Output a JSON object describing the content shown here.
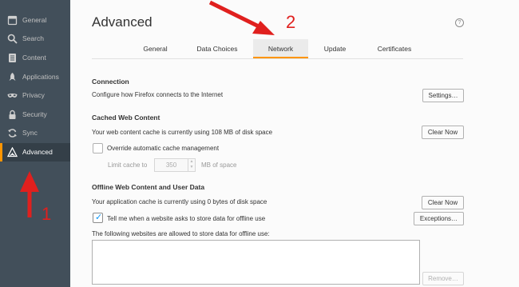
{
  "sidebar": {
    "items": [
      {
        "label": "General",
        "icon": "general-icon"
      },
      {
        "label": "Search",
        "icon": "search-icon"
      },
      {
        "label": "Content",
        "icon": "content-icon"
      },
      {
        "label": "Applications",
        "icon": "applications-icon"
      },
      {
        "label": "Privacy",
        "icon": "privacy-mask-icon"
      },
      {
        "label": "Security",
        "icon": "security-lock-icon"
      },
      {
        "label": "Sync",
        "icon": "sync-icon"
      },
      {
        "label": "Advanced",
        "icon": "advanced-icon",
        "active": true
      }
    ]
  },
  "header": {
    "title": "Advanced",
    "help_symbol": "?"
  },
  "tabs": [
    {
      "label": "General"
    },
    {
      "label": "Data Choices"
    },
    {
      "label": "Network",
      "active": true
    },
    {
      "label": "Update"
    },
    {
      "label": "Certificates"
    }
  ],
  "connection": {
    "title": "Connection",
    "description": "Configure how Firefox connects to the Internet",
    "settings_button": "Settings…"
  },
  "cache": {
    "title": "Cached Web Content",
    "description": "Your web content cache is currently using 108 MB of disk space",
    "clear_button": "Clear Now",
    "override_label": "Override automatic cache management",
    "override_checked": false,
    "limit_label": "Limit cache to",
    "limit_value": "350",
    "limit_unit": "MB of space"
  },
  "offline": {
    "title": "Offline Web Content and User Data",
    "description": "Your application cache is currently using 0 bytes of disk space",
    "clear_button": "Clear Now",
    "tell_me_label": "Tell me when a website asks to store data for offline use",
    "tell_me_checked": true,
    "exceptions_button": "Exceptions…",
    "allowed_label": "The following websites are allowed to store data for offline use:",
    "remove_button": "Remove…"
  },
  "annotations": {
    "label_1": "1",
    "label_2": "2",
    "color": "#e0201e"
  },
  "colors": {
    "sidebar_bg": "#424f5a",
    "accent": "#ff9500",
    "check": "#0996f8"
  }
}
